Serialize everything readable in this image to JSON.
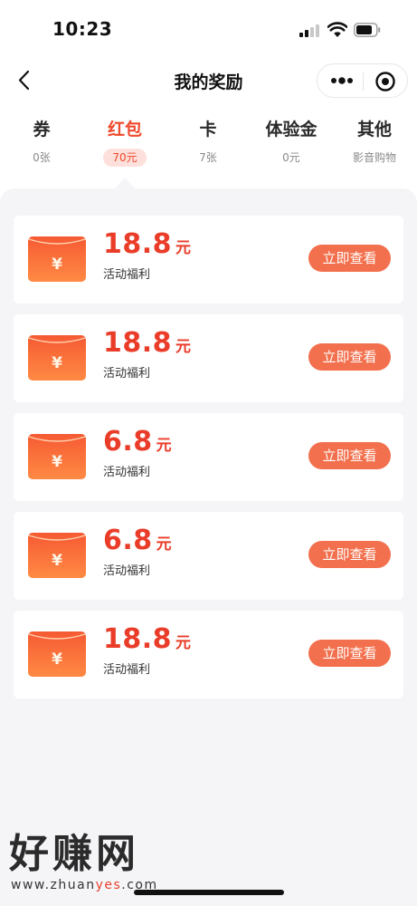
{
  "status_bar": {
    "time": "10:23"
  },
  "nav": {
    "title": "我的奖励"
  },
  "tabs": [
    {
      "label": "券",
      "count": "0张"
    },
    {
      "label": "红包",
      "count": "70元"
    },
    {
      "label": "卡",
      "count": "7张"
    },
    {
      "label": "体验金",
      "count": "0元"
    },
    {
      "label": "其他",
      "count": "影音购物"
    }
  ],
  "active_tab": "红包",
  "cards": [
    {
      "amount": "18.8",
      "unit": "元",
      "desc": "活动福利",
      "button": "立即查看"
    },
    {
      "amount": "18.8",
      "unit": "元",
      "desc": "活动福利",
      "button": "立即查看"
    },
    {
      "amount": "6.8",
      "unit": "元",
      "desc": "活动福利",
      "button": "立即查看"
    },
    {
      "amount": "6.8",
      "unit": "元",
      "desc": "活动福利",
      "button": "立即查看"
    },
    {
      "amount": "18.8",
      "unit": "元",
      "desc": "活动福利",
      "button": "立即查看"
    }
  ],
  "envelope_symbol": "¥",
  "watermark": {
    "title": "好赚网",
    "url_prefix": "www.zhuan",
    "url_highlight": "yes",
    "url_suffix": ".com"
  },
  "colors": {
    "accent": "#ea3d29",
    "button": "#f2704d",
    "envelope": "#f65a33",
    "background": "#f5f5f8"
  },
  "icons": [
    "signal-icon",
    "wifi-icon",
    "battery-icon",
    "back-chevron-icon",
    "more-dots-icon",
    "target-circle-icon",
    "yen-icon"
  ]
}
